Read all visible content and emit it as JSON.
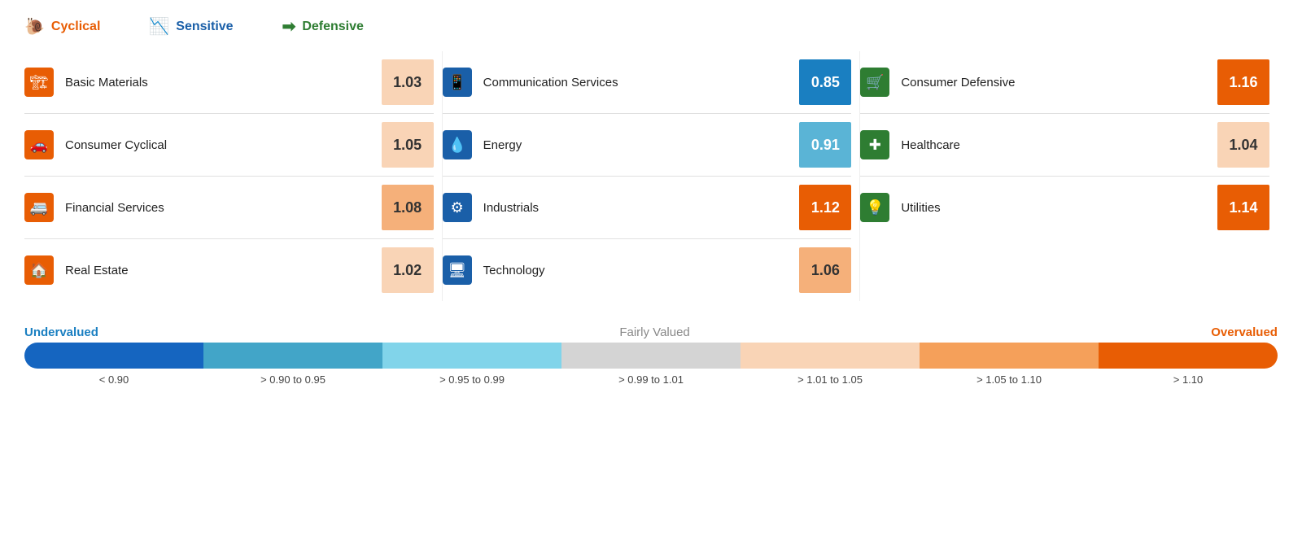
{
  "legend": {
    "cyclical_label": "Cyclical",
    "sensitive_label": "Sensitive",
    "defensive_label": "Defensive"
  },
  "cyclical_sectors": [
    {
      "name": "Basic Materials",
      "value": "1.03",
      "color_class": "val-peach-light",
      "icon": "&#9776;"
    },
    {
      "name": "Consumer Cyclical",
      "value": "1.05",
      "color_class": "val-peach-light",
      "icon": "&#128663;"
    },
    {
      "name": "Financial Services",
      "value": "1.08",
      "color_class": "val-peach-mid",
      "icon": "&#128648;"
    },
    {
      "name": "Real Estate",
      "value": "1.02",
      "color_class": "val-peach-light",
      "icon": "&#127968;"
    }
  ],
  "sensitive_sectors": [
    {
      "name": "Communication Services",
      "value": "0.85",
      "color_class": "val-blue-dark",
      "icon": "&#128241;"
    },
    {
      "name": "Energy",
      "value": "0.91",
      "color_class": "val-blue-mid",
      "icon": "&#128167;"
    },
    {
      "name": "Industrials",
      "value": "1.12",
      "color_class": "val-orange",
      "icon": "&#9881;"
    },
    {
      "name": "Technology",
      "value": "1.06",
      "color_class": "val-peach-mid",
      "icon": "&#128187;"
    }
  ],
  "defensive_sectors": [
    {
      "name": "Consumer Defensive",
      "value": "1.16",
      "color_class": "val-orange",
      "icon": "&#128722;"
    },
    {
      "name": "Healthcare",
      "value": "1.04",
      "color_class": "val-peach-light",
      "icon": "&#10010;"
    },
    {
      "name": "Utilities",
      "value": "1.14",
      "color_class": "val-orange",
      "icon": "&#128161;"
    }
  ],
  "bar_segments": [
    {
      "color": "#1565c0"
    },
    {
      "color": "#42a5c8"
    },
    {
      "color": "#81d4ea"
    },
    {
      "color": "#d4d4d4"
    },
    {
      "color": "#f9d4b6"
    },
    {
      "color": "#f5a05a"
    },
    {
      "color": "#e85d04"
    }
  ],
  "range_labels": [
    "< 0.90",
    "> 0.90 to 0.95",
    "> 0.95 to 0.99",
    "> 0.99 to 1.01",
    "> 1.01 to 1.05",
    "> 1.05 to 1.10",
    "> 1.10"
  ],
  "undervalued_label": "Undervalued",
  "fairly_valued_label": "Fairly Valued",
  "overvalued_label": "Overvalued"
}
